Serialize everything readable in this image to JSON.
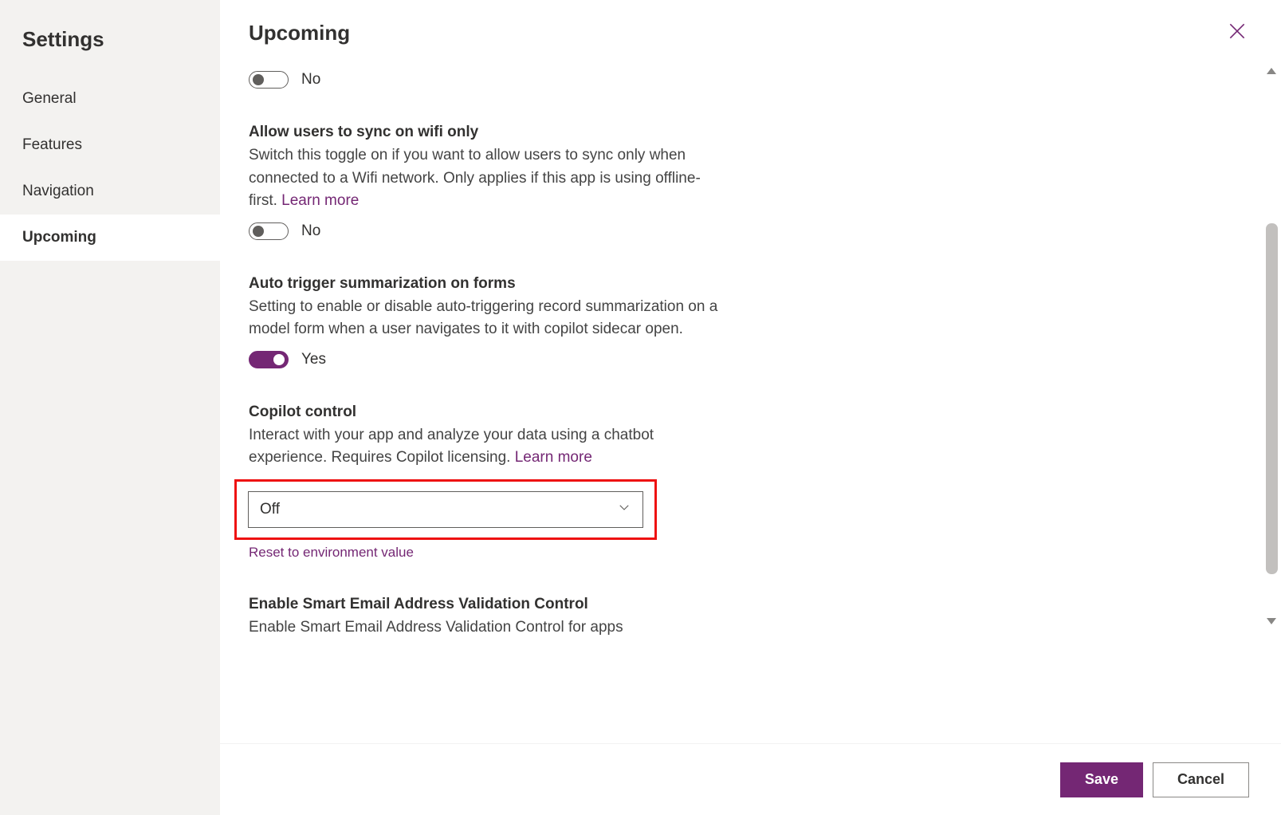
{
  "sidebar": {
    "title": "Settings",
    "items": [
      {
        "label": "General"
      },
      {
        "label": "Features"
      },
      {
        "label": "Navigation"
      },
      {
        "label": "Upcoming"
      }
    ],
    "active_index": 3
  },
  "header": {
    "title": "Upcoming"
  },
  "settings": {
    "orphan_toggle": {
      "state": "off",
      "label": "No"
    },
    "wifi": {
      "title": "Allow users to sync on wifi only",
      "desc": "Switch this toggle on if you want to allow users to sync only when connected to a Wifi network. Only applies if this app is using offline-first. ",
      "learn_more": "Learn more",
      "toggle": {
        "state": "off",
        "label": "No"
      }
    },
    "summarization": {
      "title": "Auto trigger summarization on forms",
      "desc": "Setting to enable or disable auto-triggering record summarization on a model form when a user navigates to it with copilot sidecar open.",
      "toggle": {
        "state": "on",
        "label": "Yes"
      }
    },
    "copilot": {
      "title": "Copilot control",
      "desc": "Interact with your app and analyze your data using a chatbot experience. Requires Copilot licensing. ",
      "learn_more": "Learn more",
      "selected": "Off",
      "reset_link": "Reset to environment value"
    },
    "smart_email": {
      "title": "Enable Smart Email Address Validation Control",
      "desc": "Enable Smart Email Address Validation Control for apps"
    }
  },
  "footer": {
    "save": "Save",
    "cancel": "Cancel"
  },
  "colors": {
    "accent": "#742774",
    "sidebar_bg": "#f3f2f0",
    "highlight_box": "#e11"
  }
}
